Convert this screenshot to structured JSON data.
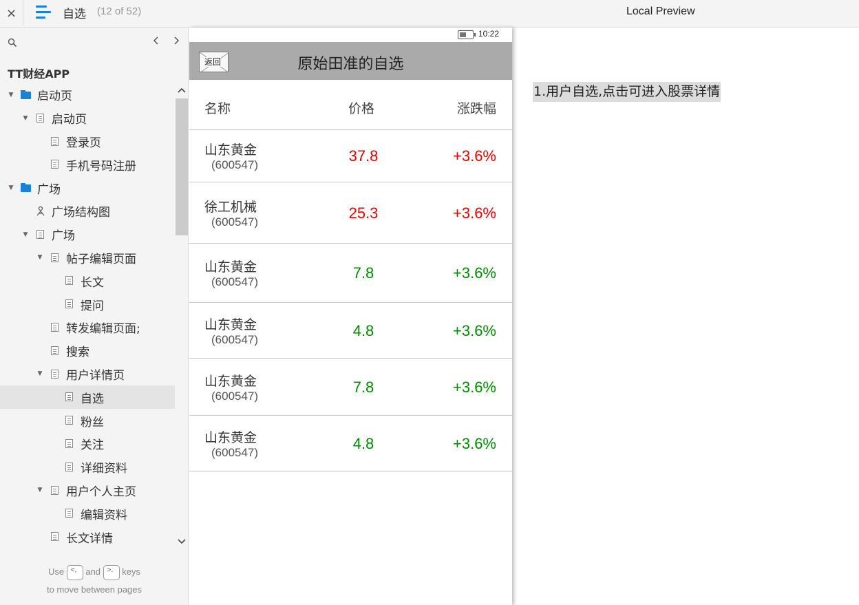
{
  "topbar": {
    "close_icon": "×",
    "page_name": "自选",
    "page_count": "(12 of 52)",
    "preview_title": "Local Preview"
  },
  "sidebar": {
    "project_title": "TT财经APP",
    "tree": [
      {
        "label": "启动页",
        "level": 0,
        "icon": "folder-icon",
        "expanded": true
      },
      {
        "label": "启动页",
        "level": 1,
        "icon": "page-icon",
        "expanded": true
      },
      {
        "label": "登录页",
        "level": 2,
        "icon": "page-icon"
      },
      {
        "label": "手机号码注册",
        "level": 2,
        "icon": "page-icon"
      },
      {
        "label": "广场",
        "level": 0,
        "icon": "folder-icon",
        "expanded": true
      },
      {
        "label": "广场结构图",
        "level": 1,
        "icon": "flow-icon"
      },
      {
        "label": "广场",
        "level": 1,
        "icon": "page-icon",
        "expanded": true
      },
      {
        "label": "帖子编辑页面",
        "level": 2,
        "icon": "page-icon",
        "expanded": true
      },
      {
        "label": "长文",
        "level": 3,
        "icon": "page-icon"
      },
      {
        "label": "提问",
        "level": 3,
        "icon": "page-icon"
      },
      {
        "label": "转发编辑页面;",
        "level": 2,
        "icon": "page-icon"
      },
      {
        "label": "搜索",
        "level": 2,
        "icon": "page-icon"
      },
      {
        "label": "用户详情页",
        "level": 2,
        "icon": "page-icon",
        "expanded": true
      },
      {
        "label": "自选",
        "level": 3,
        "icon": "page-icon",
        "selected": true
      },
      {
        "label": "粉丝",
        "level": 3,
        "icon": "page-icon"
      },
      {
        "label": "关注",
        "level": 3,
        "icon": "page-icon"
      },
      {
        "label": "详细资料",
        "level": 3,
        "icon": "page-icon"
      },
      {
        "label": "用户个人主页",
        "level": 2,
        "icon": "page-icon",
        "expanded": true
      },
      {
        "label": "编辑资料",
        "level": 3,
        "icon": "page-icon"
      },
      {
        "label": "长文详情",
        "level": 2,
        "icon": "page-icon"
      }
    ],
    "hint": {
      "use": "Use",
      "key_prev": "<,",
      "and": "and",
      "key_next": ">.",
      "keys": "keys",
      "line2": "to move between pages"
    }
  },
  "phone": {
    "time": "10:22",
    "back_label": "返回",
    "title": "原始田准的自选",
    "headers": {
      "name": "名称",
      "price": "价格",
      "change": "涨跌幅"
    },
    "rows": [
      {
        "name": "山东黄金",
        "code": "(600547)",
        "price": "37.8",
        "change": "+3.6%",
        "price_color": "#e60000",
        "change_color": "#e60000"
      },
      {
        "name": "徐工机械",
        "code": "(600547)",
        "price": "25.3",
        "change": "+3.6%",
        "price_color": "#e60000",
        "change_color": "#e60000"
      },
      {
        "name": "山东黄金",
        "code": "(600547)",
        "price": "7.8",
        "change": "+3.6%",
        "price_color": "#008a00",
        "change_color": "#008a00"
      },
      {
        "name": "山东黄金",
        "code": "(600547)",
        "price": "4.8",
        "change": "+3.6%",
        "price_color": "#008a00",
        "change_color": "#008a00"
      },
      {
        "name": "山东黄金",
        "code": "(600547)",
        "price": "7.8",
        "change": "+3.6%",
        "price_color": "#008a00",
        "change_color": "#008a00"
      },
      {
        "name": "山东黄金",
        "code": "(600547)",
        "price": "4.8",
        "change": "+3.6%",
        "price_color": "#008a00",
        "change_color": "#008a00"
      }
    ]
  },
  "note": "1.用户自选,点击可进入股票详情"
}
